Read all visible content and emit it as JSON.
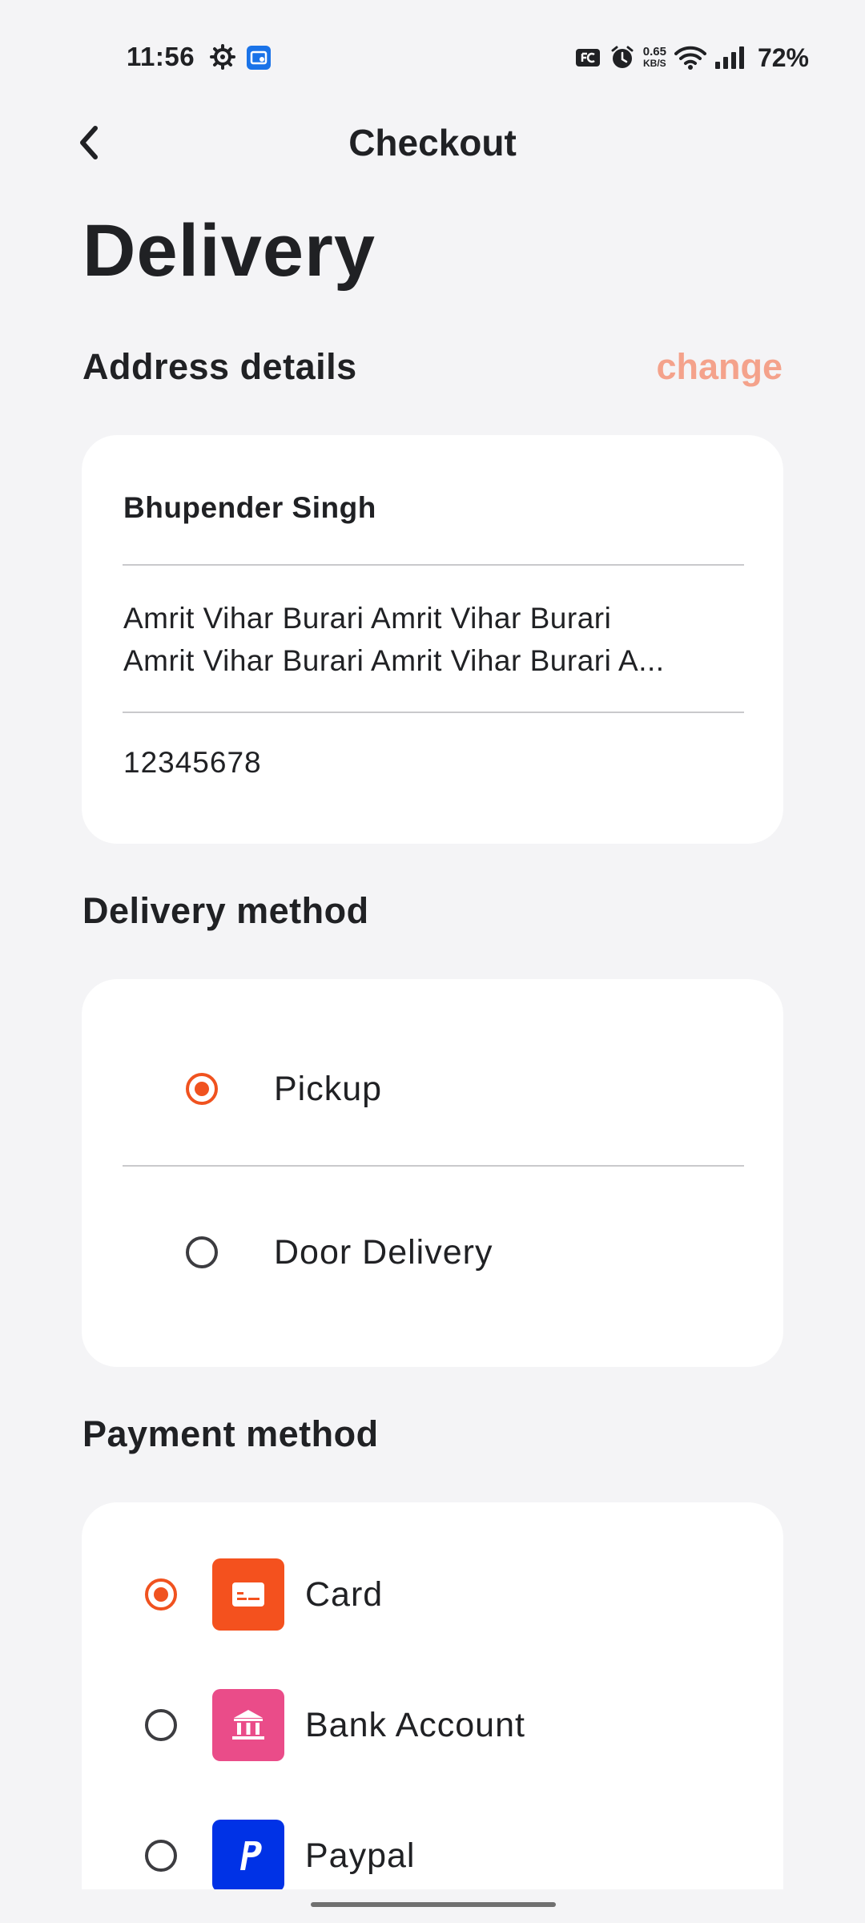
{
  "status_bar": {
    "time": "11:56",
    "net_speed_value": "0.65",
    "net_speed_unit": "KB/S",
    "battery": "72%"
  },
  "header": {
    "title": "Checkout"
  },
  "page_title": "Delivery",
  "address": {
    "section_title": "Address details",
    "change_label": "change",
    "name": "Bhupender Singh",
    "line1": "Amrit Vihar Burari Amrit Vihar Burari",
    "line2": "Amrit Vihar Burari Amrit Vihar Burari A...",
    "phone": "12345678"
  },
  "delivery_method": {
    "section_title": "Delivery method",
    "options": [
      {
        "label": "Pickup",
        "selected": true
      },
      {
        "label": "Door Delivery",
        "selected": false
      }
    ]
  },
  "payment_method": {
    "section_title": "Payment method",
    "options": [
      {
        "label": "Card",
        "selected": true,
        "icon": "card-icon",
        "color": "#f4511e"
      },
      {
        "label": "Bank Account",
        "selected": false,
        "icon": "bank-icon",
        "color": "#ea4c89"
      },
      {
        "label": "Paypal",
        "selected": false,
        "icon": "paypal-icon",
        "color": "#0032e6"
      }
    ]
  },
  "colors": {
    "accent": "#f0521f",
    "change_link": "#f4a28b",
    "background": "#f4f4f6"
  }
}
